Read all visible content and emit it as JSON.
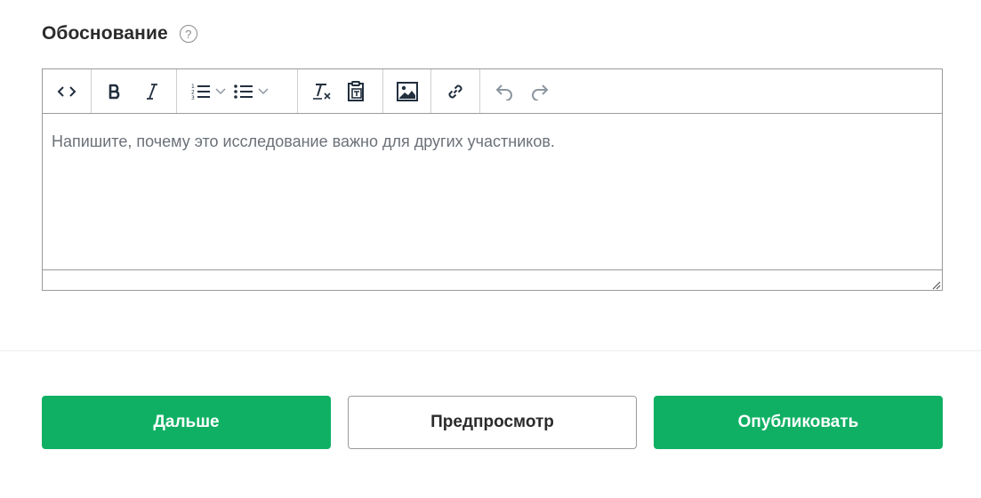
{
  "field": {
    "label": "Обоснование",
    "help_glyph": "?"
  },
  "editor": {
    "placeholder": "Напишите, почему это исследование важно для других участников.",
    "toolbar": [
      "code-icon",
      "bold-icon",
      "italic-icon",
      "numbered-list-icon",
      "bulleted-list-icon",
      "clear-formatting-icon",
      "paste-as-text-icon",
      "image-icon",
      "link-icon",
      "undo-icon",
      "redo-icon"
    ]
  },
  "actions": {
    "next_label": "Дальше",
    "preview_label": "Предпросмотр",
    "publish_label": "Опубликовать"
  },
  "colors": {
    "primary": "#10b064",
    "icon": "#222f3e",
    "icon_disabled": "#8c96a0",
    "border": "#9a9a9a"
  }
}
